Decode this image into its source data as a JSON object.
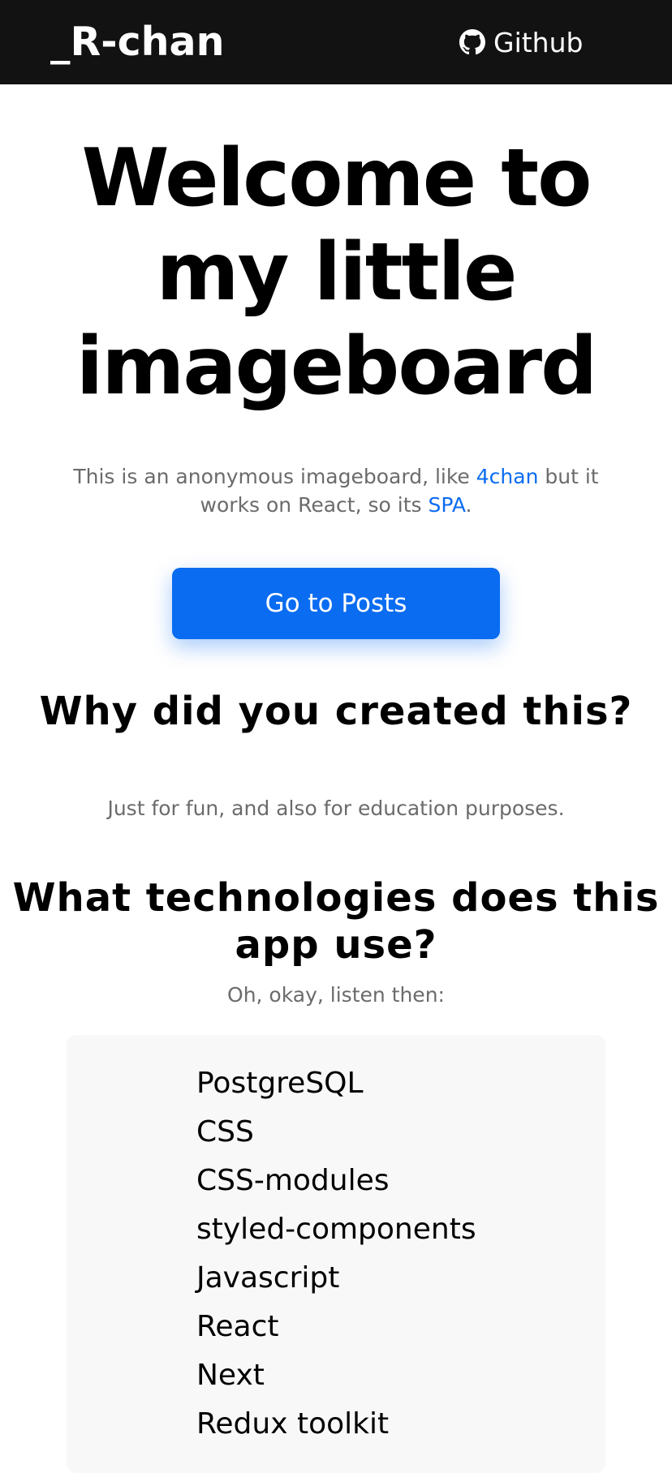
{
  "header": {
    "logo": "_R-chan",
    "github_label": "Github",
    "github_icon": "github-icon"
  },
  "hero": {
    "title_line1": "Welcome to",
    "title_line2": "my little",
    "title_line3": "imageboard",
    "subtitle_prefix": "This is an anonymous imageboard, like ",
    "subtitle_link1": "4chan",
    "subtitle_middle": " but it works on React, so its ",
    "subtitle_link2": "SPA",
    "subtitle_suffix": "."
  },
  "cta": {
    "label": "Go to Posts"
  },
  "faq": [
    {
      "question": "Why did you created this?",
      "answer": "Just for fun, and also for education purposes."
    },
    {
      "question": "What technologies does this app use?",
      "answer": "Oh, okay, listen then:"
    }
  ],
  "technologies": [
    "PostgreSQL",
    "CSS",
    "CSS-modules",
    "styled-components",
    "Javascript",
    "React",
    "Next",
    "Redux toolkit"
  ],
  "colors": {
    "header_bg": "#121212",
    "accent": "#0a6cf1",
    "muted_text": "#6b6b6b",
    "list_bg": "#f8f8f8"
  }
}
